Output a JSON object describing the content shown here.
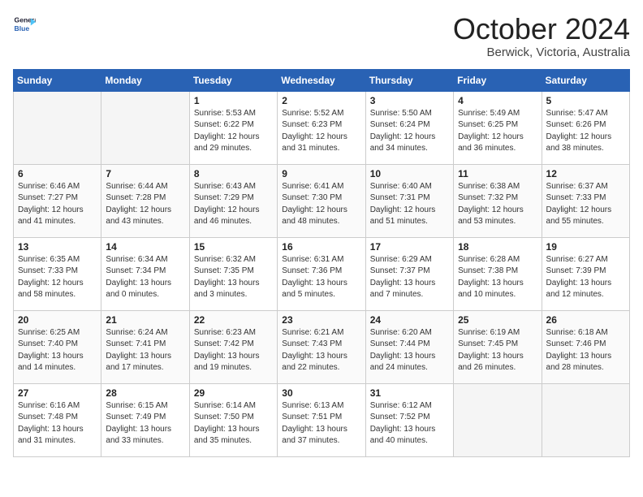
{
  "header": {
    "logo_line1": "General",
    "logo_line2": "Blue",
    "month_title": "October 2024",
    "location": "Berwick, Victoria, Australia"
  },
  "weekdays": [
    "Sunday",
    "Monday",
    "Tuesday",
    "Wednesday",
    "Thursday",
    "Friday",
    "Saturday"
  ],
  "weeks": [
    [
      {
        "day": "",
        "empty": true
      },
      {
        "day": "",
        "empty": true
      },
      {
        "day": "1",
        "sunrise": "Sunrise: 5:53 AM",
        "sunset": "Sunset: 6:22 PM",
        "daylight": "Daylight: 12 hours and 29 minutes."
      },
      {
        "day": "2",
        "sunrise": "Sunrise: 5:52 AM",
        "sunset": "Sunset: 6:23 PM",
        "daylight": "Daylight: 12 hours and 31 minutes."
      },
      {
        "day": "3",
        "sunrise": "Sunrise: 5:50 AM",
        "sunset": "Sunset: 6:24 PM",
        "daylight": "Daylight: 12 hours and 34 minutes."
      },
      {
        "day": "4",
        "sunrise": "Sunrise: 5:49 AM",
        "sunset": "Sunset: 6:25 PM",
        "daylight": "Daylight: 12 hours and 36 minutes."
      },
      {
        "day": "5",
        "sunrise": "Sunrise: 5:47 AM",
        "sunset": "Sunset: 6:26 PM",
        "daylight": "Daylight: 12 hours and 38 minutes."
      }
    ],
    [
      {
        "day": "6",
        "sunrise": "Sunrise: 6:46 AM",
        "sunset": "Sunset: 7:27 PM",
        "daylight": "Daylight: 12 hours and 41 minutes."
      },
      {
        "day": "7",
        "sunrise": "Sunrise: 6:44 AM",
        "sunset": "Sunset: 7:28 PM",
        "daylight": "Daylight: 12 hours and 43 minutes."
      },
      {
        "day": "8",
        "sunrise": "Sunrise: 6:43 AM",
        "sunset": "Sunset: 7:29 PM",
        "daylight": "Daylight: 12 hours and 46 minutes."
      },
      {
        "day": "9",
        "sunrise": "Sunrise: 6:41 AM",
        "sunset": "Sunset: 7:30 PM",
        "daylight": "Daylight: 12 hours and 48 minutes."
      },
      {
        "day": "10",
        "sunrise": "Sunrise: 6:40 AM",
        "sunset": "Sunset: 7:31 PM",
        "daylight": "Daylight: 12 hours and 51 minutes."
      },
      {
        "day": "11",
        "sunrise": "Sunrise: 6:38 AM",
        "sunset": "Sunset: 7:32 PM",
        "daylight": "Daylight: 12 hours and 53 minutes."
      },
      {
        "day": "12",
        "sunrise": "Sunrise: 6:37 AM",
        "sunset": "Sunset: 7:33 PM",
        "daylight": "Daylight: 12 hours and 55 minutes."
      }
    ],
    [
      {
        "day": "13",
        "sunrise": "Sunrise: 6:35 AM",
        "sunset": "Sunset: 7:33 PM",
        "daylight": "Daylight: 12 hours and 58 minutes."
      },
      {
        "day": "14",
        "sunrise": "Sunrise: 6:34 AM",
        "sunset": "Sunset: 7:34 PM",
        "daylight": "Daylight: 13 hours and 0 minutes."
      },
      {
        "day": "15",
        "sunrise": "Sunrise: 6:32 AM",
        "sunset": "Sunset: 7:35 PM",
        "daylight": "Daylight: 13 hours and 3 minutes."
      },
      {
        "day": "16",
        "sunrise": "Sunrise: 6:31 AM",
        "sunset": "Sunset: 7:36 PM",
        "daylight": "Daylight: 13 hours and 5 minutes."
      },
      {
        "day": "17",
        "sunrise": "Sunrise: 6:29 AM",
        "sunset": "Sunset: 7:37 PM",
        "daylight": "Daylight: 13 hours and 7 minutes."
      },
      {
        "day": "18",
        "sunrise": "Sunrise: 6:28 AM",
        "sunset": "Sunset: 7:38 PM",
        "daylight": "Daylight: 13 hours and 10 minutes."
      },
      {
        "day": "19",
        "sunrise": "Sunrise: 6:27 AM",
        "sunset": "Sunset: 7:39 PM",
        "daylight": "Daylight: 13 hours and 12 minutes."
      }
    ],
    [
      {
        "day": "20",
        "sunrise": "Sunrise: 6:25 AM",
        "sunset": "Sunset: 7:40 PM",
        "daylight": "Daylight: 13 hours and 14 minutes."
      },
      {
        "day": "21",
        "sunrise": "Sunrise: 6:24 AM",
        "sunset": "Sunset: 7:41 PM",
        "daylight": "Daylight: 13 hours and 17 minutes."
      },
      {
        "day": "22",
        "sunrise": "Sunrise: 6:23 AM",
        "sunset": "Sunset: 7:42 PM",
        "daylight": "Daylight: 13 hours and 19 minutes."
      },
      {
        "day": "23",
        "sunrise": "Sunrise: 6:21 AM",
        "sunset": "Sunset: 7:43 PM",
        "daylight": "Daylight: 13 hours and 22 minutes."
      },
      {
        "day": "24",
        "sunrise": "Sunrise: 6:20 AM",
        "sunset": "Sunset: 7:44 PM",
        "daylight": "Daylight: 13 hours and 24 minutes."
      },
      {
        "day": "25",
        "sunrise": "Sunrise: 6:19 AM",
        "sunset": "Sunset: 7:45 PM",
        "daylight": "Daylight: 13 hours and 26 minutes."
      },
      {
        "day": "26",
        "sunrise": "Sunrise: 6:18 AM",
        "sunset": "Sunset: 7:46 PM",
        "daylight": "Daylight: 13 hours and 28 minutes."
      }
    ],
    [
      {
        "day": "27",
        "sunrise": "Sunrise: 6:16 AM",
        "sunset": "Sunset: 7:48 PM",
        "daylight": "Daylight: 13 hours and 31 minutes."
      },
      {
        "day": "28",
        "sunrise": "Sunrise: 6:15 AM",
        "sunset": "Sunset: 7:49 PM",
        "daylight": "Daylight: 13 hours and 33 minutes."
      },
      {
        "day": "29",
        "sunrise": "Sunrise: 6:14 AM",
        "sunset": "Sunset: 7:50 PM",
        "daylight": "Daylight: 13 hours and 35 minutes."
      },
      {
        "day": "30",
        "sunrise": "Sunrise: 6:13 AM",
        "sunset": "Sunset: 7:51 PM",
        "daylight": "Daylight: 13 hours and 37 minutes."
      },
      {
        "day": "31",
        "sunrise": "Sunrise: 6:12 AM",
        "sunset": "Sunset: 7:52 PM",
        "daylight": "Daylight: 13 hours and 40 minutes."
      },
      {
        "day": "",
        "empty": true
      },
      {
        "day": "",
        "empty": true
      }
    ]
  ]
}
